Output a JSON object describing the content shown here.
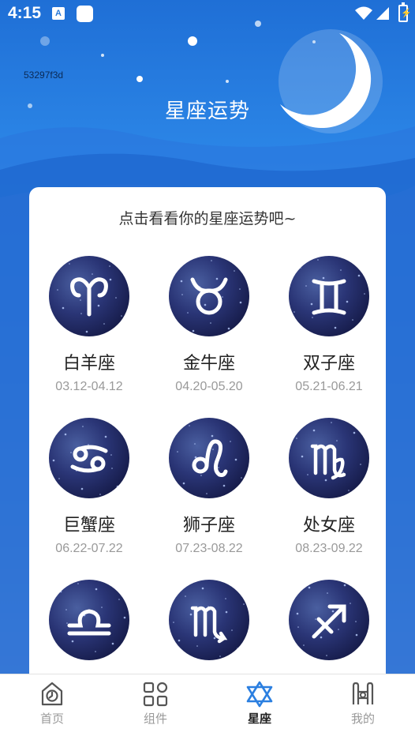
{
  "status_bar": {
    "time": "4:15",
    "notification_letter": "A"
  },
  "debug_id": "53297f3d",
  "page_title": "星座运势",
  "card": {
    "subtitle": "点击看看你的星座运势吧~",
    "signs": [
      {
        "name": "白羊座",
        "dates": "03.12-04.12",
        "glyph": "aries"
      },
      {
        "name": "金牛座",
        "dates": "04.20-05.20",
        "glyph": "taurus"
      },
      {
        "name": "双子座",
        "dates": "05.21-06.21",
        "glyph": "gemini"
      },
      {
        "name": "巨蟹座",
        "dates": "06.22-07.22",
        "glyph": "cancer"
      },
      {
        "name": "狮子座",
        "dates": "07.23-08.22",
        "glyph": "leo"
      },
      {
        "name": "处女座",
        "dates": "08.23-09.22",
        "glyph": "virgo"
      },
      {
        "name": "",
        "dates": "",
        "glyph": "libra"
      },
      {
        "name": "",
        "dates": "",
        "glyph": "scorpio"
      },
      {
        "name": "",
        "dates": "",
        "glyph": "sagittarius"
      }
    ]
  },
  "tabbar": {
    "tabs": [
      {
        "label": "首页",
        "icon": "home-icon",
        "active": false
      },
      {
        "label": "组件",
        "icon": "grid-icon",
        "active": false
      },
      {
        "label": "星座",
        "icon": "star-of-david-icon",
        "active": true
      },
      {
        "label": "我的",
        "icon": "profile-icon",
        "active": false
      }
    ],
    "active_color": "#2b7fe0",
    "inactive_color": "#555555"
  }
}
